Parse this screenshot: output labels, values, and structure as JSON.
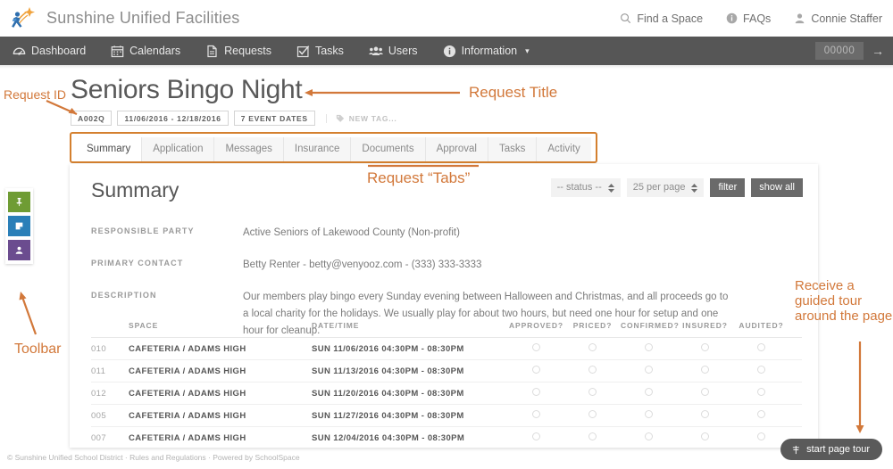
{
  "header": {
    "brand": "Sunshine Unified Facilities",
    "logo_icon": "running-star-logo-icon",
    "links": [
      {
        "label": "Find a Space",
        "icon": "search-icon"
      },
      {
        "label": "FAQs",
        "icon": "info-circle-icon"
      },
      {
        "label": "Connie Staffer",
        "icon": "user-icon"
      }
    ]
  },
  "nav": {
    "items": [
      {
        "label": "Dashboard",
        "icon": "gauge-icon",
        "caret": false
      },
      {
        "label": "Calendars",
        "icon": "calendar-icon",
        "caret": false
      },
      {
        "label": "Requests",
        "icon": "document-icon",
        "caret": false
      },
      {
        "label": "Tasks",
        "icon": "check-square-icon",
        "caret": false
      },
      {
        "label": "Users",
        "icon": "users-icon",
        "caret": false
      },
      {
        "label": "Information",
        "icon": "info-circle-icon",
        "caret": true
      }
    ],
    "caret_glyph": "▾",
    "quick_input_value": "00000",
    "quick_input_placeholder": "00000",
    "go_arrow": "→"
  },
  "request": {
    "title": "Seniors Bingo Night",
    "id_chip": "A002Q",
    "date_range_chip": "11/06/2016 - 12/18/2016",
    "event_dates_chip": "7 EVENT DATES",
    "new_tag_label": "NEW TAG...",
    "new_tag_icon": "tag-icon"
  },
  "tabs": [
    {
      "label": "Summary",
      "active": true
    },
    {
      "label": "Application",
      "active": false
    },
    {
      "label": "Messages",
      "active": false
    },
    {
      "label": "Insurance",
      "active": false
    },
    {
      "label": "Documents",
      "active": false
    },
    {
      "label": "Approval",
      "active": false
    },
    {
      "label": "Tasks",
      "active": false
    },
    {
      "label": "Activity",
      "active": false
    }
  ],
  "card": {
    "title": "Summary",
    "controls": {
      "status_select": "-- status --",
      "per_page_select": "25 per page",
      "filter_button": "filter",
      "show_all_button": "show all"
    },
    "fields": [
      {
        "label": "RESPONSIBLE PARTY",
        "value": "Active Seniors of Lakewood County (Non-profit)"
      },
      {
        "label": "PRIMARY CONTACT",
        "value": "Betty Renter - betty@venyooz.com - (333) 333-3333"
      },
      {
        "label": "DESCRIPTION",
        "value": "Our members play bingo every Sunday evening between Halloween and Christmas, and all proceeds go to a local charity for the holidays. We usually play for about two hours, but need one hour for setup and one hour for cleanup."
      }
    ],
    "table": {
      "columns": [
        "",
        "SPACE",
        "DATE/TIME",
        "APPROVED?",
        "PRICED?",
        "CONFIRMED?",
        "INSURED?",
        "AUDITED?"
      ],
      "rows": [
        {
          "id": "010",
          "space": "CAFETERIA / ADAMS HIGH",
          "datetime": "SUN 11/06/2016 04:30PM - 08:30PM"
        },
        {
          "id": "011",
          "space": "CAFETERIA / ADAMS HIGH",
          "datetime": "SUN 11/13/2016 04:30PM - 08:30PM"
        },
        {
          "id": "012",
          "space": "CAFETERIA / ADAMS HIGH",
          "datetime": "SUN 11/20/2016 04:30PM - 08:30PM"
        },
        {
          "id": "005",
          "space": "CAFETERIA / ADAMS HIGH",
          "datetime": "SUN 11/27/2016 04:30PM - 08:30PM"
        },
        {
          "id": "007",
          "space": "CAFETERIA / ADAMS HIGH",
          "datetime": "SUN 12/04/2016 04:30PM - 08:30PM"
        }
      ]
    }
  },
  "toolbar": {
    "buttons": [
      {
        "icon": "pin-icon",
        "color": "#6f9c34"
      },
      {
        "icon": "note-icon",
        "color": "#2a7fb8"
      },
      {
        "icon": "person-icon",
        "color": "#6b4c8f"
      }
    ]
  },
  "tour": {
    "button_label": "start page tour",
    "button_icon": "flag-icon"
  },
  "footer": {
    "text": "© Sunshine Unified School District · Rules and Regulations · Powered by SchoolSpace"
  },
  "annotations": {
    "request_id": "Request ID",
    "request_title": "Request Title",
    "request_tabs": "Request “Tabs”",
    "toolbar": "Toolbar",
    "tour": "Receive a guided tour around the page",
    "color": "#d2783a"
  }
}
